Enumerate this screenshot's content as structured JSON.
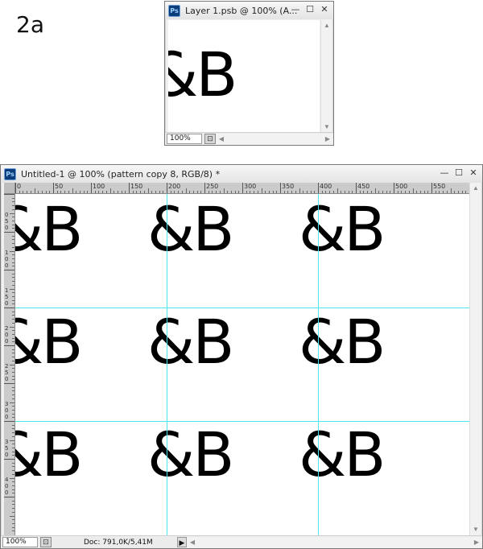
{
  "step_label": "2a",
  "small_window": {
    "title": "Layer 1.psb @ 100% (A...",
    "app_icon": "Ps",
    "zoom": "100%",
    "canvas_text": "&B"
  },
  "main_window": {
    "title": "Untitled-1 @ 100% (pattern copy 8, RGB/8) *",
    "app_icon": "Ps",
    "zoom": "100%",
    "doc_info": "Doc: 791,0K/5,41M",
    "canvas_text": "&B",
    "ruler_h_labels": [
      "0",
      "50",
      "100",
      "150",
      "200",
      "250",
      "300",
      "350",
      "400",
      "450",
      "500",
      "550"
    ],
    "ruler_v_labels": [
      "0",
      "5",
      "0",
      "1",
      "0",
      "0",
      "1",
      "5",
      "0",
      "2",
      "0",
      "0",
      "2",
      "5",
      "0",
      "3",
      "0",
      "0",
      "3",
      "5",
      "0",
      "4",
      "0",
      "0"
    ]
  },
  "window_controls": {
    "minimize": "—",
    "maximize": "☐",
    "close": "✕"
  },
  "colors": {
    "guide": "#49e6ee",
    "ps_icon_bg": "#0a3d7a"
  }
}
